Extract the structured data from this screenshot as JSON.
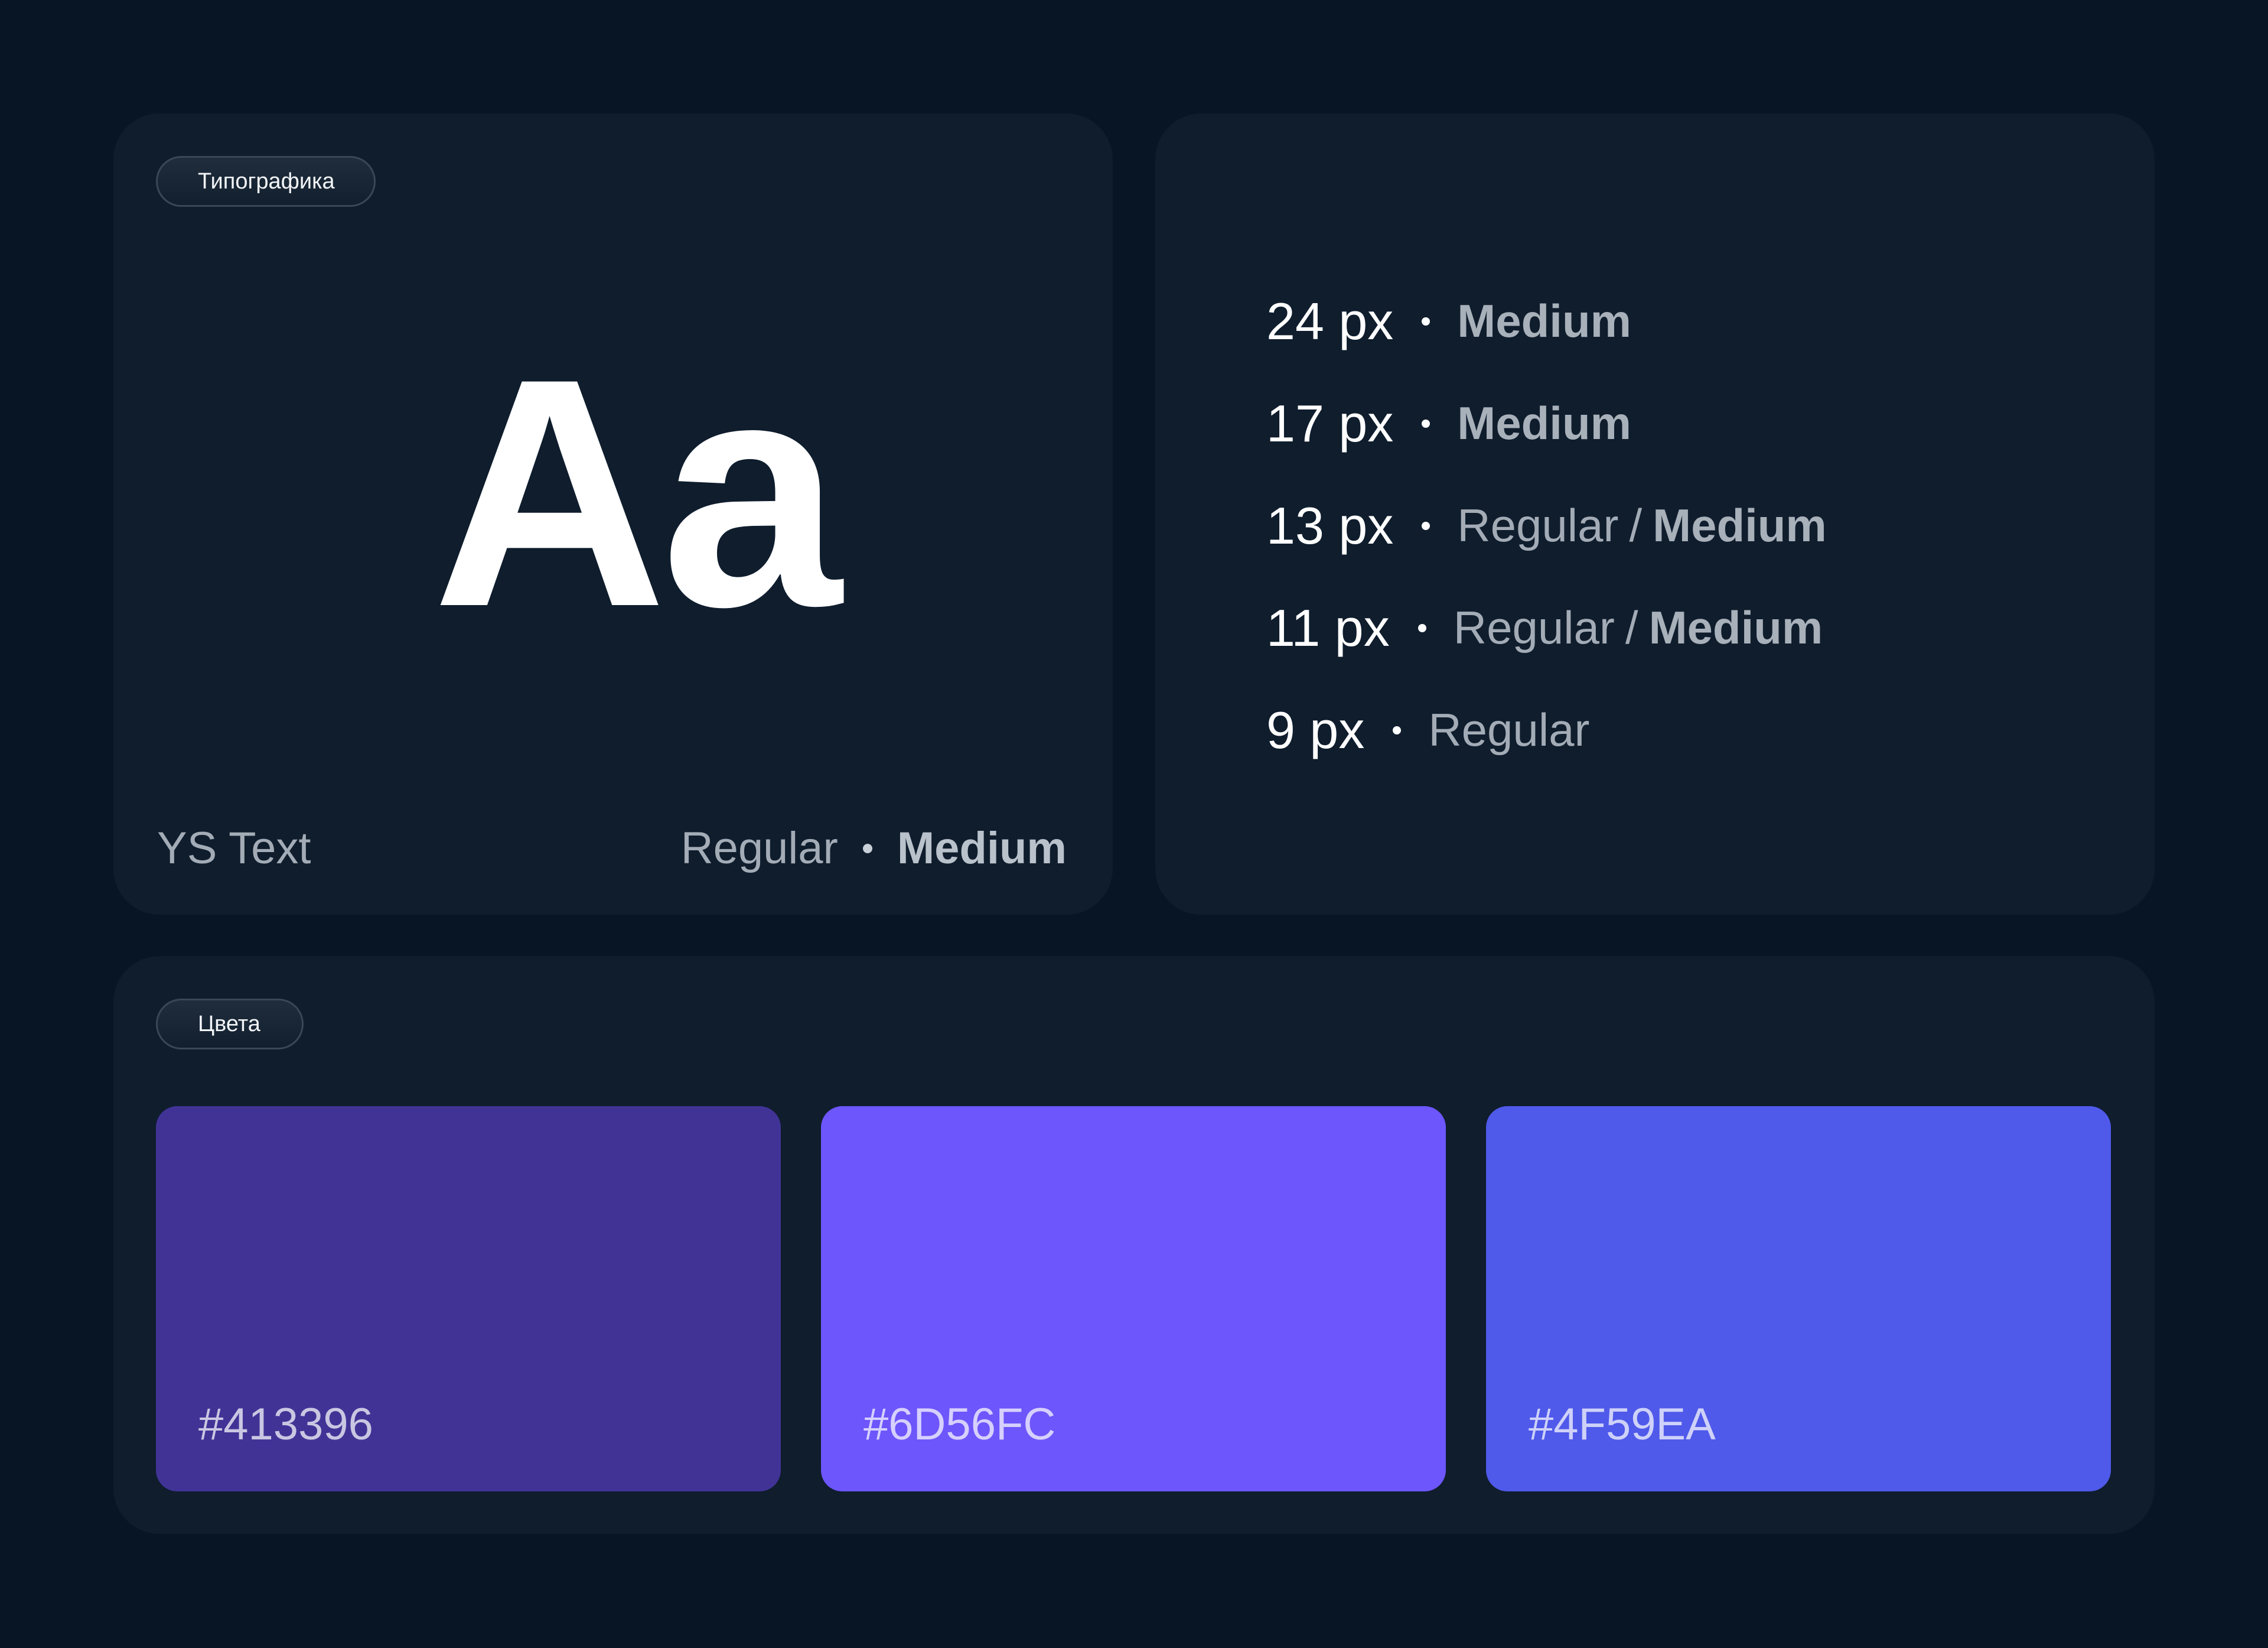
{
  "typography_card": {
    "pill": "Типографика",
    "specimen": "Aa",
    "font_name": "YS Text",
    "weight_regular": "Regular",
    "weight_medium": "Medium"
  },
  "sizes_card": {
    "rows": [
      {
        "size": "24 px",
        "weights": [
          "Medium"
        ],
        "styles": [
          "strong"
        ]
      },
      {
        "size": "17 px",
        "weights": [
          "Medium"
        ],
        "styles": [
          "strong"
        ]
      },
      {
        "size": "13 px",
        "weights": [
          "Regular",
          "Medium"
        ],
        "styles": [
          "normal",
          "strong"
        ]
      },
      {
        "size": "11 px",
        "weights": [
          "Regular",
          "Medium"
        ],
        "styles": [
          "normal",
          "strong"
        ]
      },
      {
        "size": "9 px",
        "weights": [
          "Regular"
        ],
        "styles": [
          "normal"
        ]
      }
    ]
  },
  "colors_card": {
    "pill": "Цвета",
    "swatches": [
      {
        "label": "#413396",
        "color": "#413396"
      },
      {
        "label": "#6D56FC",
        "color": "#6D56FC"
      },
      {
        "label": "#4F59EA",
        "color": "#4F59EA"
      }
    ]
  },
  "theme": {
    "page_background": "#071524",
    "card_background": "#0F1D2D",
    "muted_text": "#A3ACB6"
  }
}
